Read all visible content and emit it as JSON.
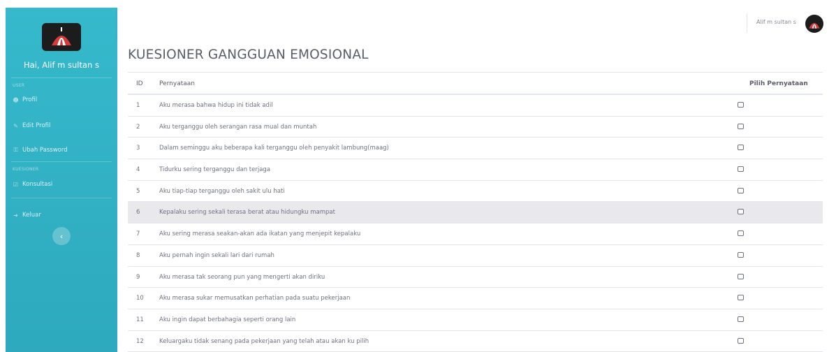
{
  "sidebar": {
    "greeting": "Hai, Alif m sultan s",
    "section_user": "USER",
    "profile": "Profil",
    "edit_profile": "Edit Profil",
    "change_password": "Ubah Password",
    "section_kuesioner": "KUESIONER",
    "consultation": "Konsultasi",
    "logout": "Keluar",
    "collapse": "‹"
  },
  "topbar": {
    "user_name": "Alif m sultan s"
  },
  "page": {
    "title": "KUESIONER GANGGUAN EMOSIONAL"
  },
  "table": {
    "headers": {
      "id": "ID",
      "statement": "Pernyataan",
      "pick": "Pilih Pernyataan"
    },
    "rows": [
      {
        "id": "1",
        "text": "Aku merasa bahwa hidup ini tidak adil"
      },
      {
        "id": "2",
        "text": "Aku terganggu oleh serangan rasa mual dan muntah"
      },
      {
        "id": "3",
        "text": "Dalam seminggu aku beberapa kali terganggu oleh penyakit lambung(maag)"
      },
      {
        "id": "4",
        "text": "Tidurku sering terganggu dan terjaga"
      },
      {
        "id": "5",
        "text": "Aku tiap-tiap terganggu oleh sakit ulu hati"
      },
      {
        "id": "6",
        "text": "Kepalaku sering sekali terasa berat atau hidungku mampat"
      },
      {
        "id": "7",
        "text": "Aku sering merasa seakan-akan ada ikatan yang menjepit kepalaku"
      },
      {
        "id": "8",
        "text": "Aku pernah ingin sekali lari dari rumah"
      },
      {
        "id": "9",
        "text": "Aku merasa tak seorang pun yang mengerti akan diriku"
      },
      {
        "id": "10",
        "text": "Aku merasa sukar memusatkan perhatian pada suatu pekerjaan"
      },
      {
        "id": "11",
        "text": "Aku ingin dapat berbahagia seperti orang lain"
      },
      {
        "id": "12",
        "text": "Keluargaku tidak senang pada pekerjaan yang telah atau akan ku pilih"
      }
    ]
  },
  "colors": {
    "sidebar": "#36b9cc",
    "row_highlight": "#e9e9ec"
  }
}
